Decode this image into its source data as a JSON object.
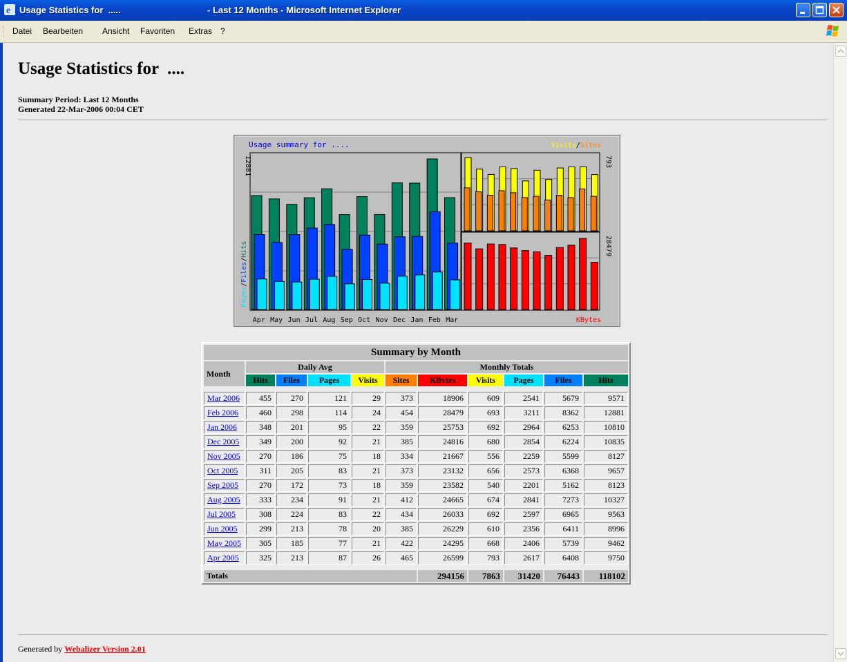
{
  "window": {
    "title_left": "Usage Statistics for  .....",
    "title_right": "- Last 12 Months - Microsoft Internet Explorer"
  },
  "menu": [
    "Datei",
    "Bearbeiten",
    "Ansicht",
    "Favoriten",
    "Extras",
    "?"
  ],
  "page": {
    "title": "Usage Statistics for  ....",
    "summary_period": "Summary Period: Last 12 Months",
    "generated": "Generated 22-Mar-2006 00:04 CET"
  },
  "colors": {
    "hits": "#00805c",
    "files": "#0040ff",
    "pages": "#00e0ff",
    "visits": "#ffff00",
    "sites": "#ff8000",
    "kbytes": "#ff0000",
    "chart_bg": "#c0c0c0",
    "chart_title": "#0000ff"
  },
  "chart_data": {
    "type": "bar",
    "title": "Usage summary for ....",
    "categories": [
      "Apr",
      "May",
      "Jun",
      "Jul",
      "Aug",
      "Sep",
      "Oct",
      "Nov",
      "Dec",
      "Jan",
      "Feb",
      "Mar"
    ],
    "left_panel": {
      "axis_label_parts": [
        "Pages",
        "Files",
        "Hits"
      ],
      "max_label": "12881",
      "series": [
        {
          "name": "Hits",
          "values": [
            9750,
            9462,
            8996,
            9563,
            10327,
            8123,
            9657,
            8127,
            10835,
            10810,
            12881,
            9571
          ]
        },
        {
          "name": "Files",
          "values": [
            6408,
            5739,
            6411,
            6965,
            7273,
            5162,
            6368,
            5599,
            6224,
            6253,
            8362,
            5679
          ]
        },
        {
          "name": "Pages",
          "values": [
            2617,
            2406,
            2356,
            2597,
            2841,
            2201,
            2573,
            2259,
            2854,
            2964,
            3211,
            2541
          ]
        }
      ]
    },
    "top_right_panel": {
      "legend_parts": [
        "Visits",
        "Sites"
      ],
      "max_label": "793",
      "series": [
        {
          "name": "Visits",
          "values": [
            793,
            668,
            610,
            692,
            674,
            540,
            656,
            556,
            680,
            692,
            693,
            609
          ]
        },
        {
          "name": "Sites",
          "values": [
            465,
            422,
            385,
            434,
            412,
            359,
            373,
            334,
            385,
            359,
            454,
            373
          ]
        }
      ]
    },
    "bottom_right_panel": {
      "legend": "KBytes",
      "max_label": "28479",
      "series": [
        {
          "name": "KBytes",
          "values": [
            26599,
            24295,
            26229,
            26033,
            24665,
            23582,
            23132,
            21667,
            24816,
            25753,
            28479,
            18906
          ]
        }
      ]
    }
  },
  "table": {
    "caption": "Summary by Month",
    "month_header": "Month",
    "daily_avg_header": "Daily Avg",
    "monthly_totals_header": "Monthly Totals",
    "daily_cols": [
      "Hits",
      "Files",
      "Pages",
      "Visits"
    ],
    "monthly_cols": [
      "Sites",
      "KBytes",
      "Visits",
      "Pages",
      "Files",
      "Hits"
    ],
    "rows": [
      {
        "month": "Mar 2006",
        "vals": [
          "455",
          "270",
          "121",
          "29",
          "373",
          "18906",
          "609",
          "2541",
          "5679",
          "9571"
        ]
      },
      {
        "month": "Feb 2006",
        "vals": [
          "460",
          "298",
          "114",
          "24",
          "454",
          "28479",
          "693",
          "3211",
          "8362",
          "12881"
        ]
      },
      {
        "month": "Jan 2006",
        "vals": [
          "348",
          "201",
          "95",
          "22",
          "359",
          "25753",
          "692",
          "2964",
          "6253",
          "10810"
        ]
      },
      {
        "month": "Dec 2005",
        "vals": [
          "349",
          "200",
          "92",
          "21",
          "385",
          "24816",
          "680",
          "2854",
          "6224",
          "10835"
        ]
      },
      {
        "month": "Nov 2005",
        "vals": [
          "270",
          "186",
          "75",
          "18",
          "334",
          "21667",
          "556",
          "2259",
          "5599",
          "8127"
        ]
      },
      {
        "month": "Oct 2005",
        "vals": [
          "311",
          "205",
          "83",
          "21",
          "373",
          "23132",
          "656",
          "2573",
          "6368",
          "9657"
        ]
      },
      {
        "month": "Sep 2005",
        "vals": [
          "270",
          "172",
          "73",
          "18",
          "359",
          "23582",
          "540",
          "2201",
          "5162",
          "8123"
        ]
      },
      {
        "month": "Aug 2005",
        "vals": [
          "333",
          "234",
          "91",
          "21",
          "412",
          "24665",
          "674",
          "2841",
          "7273",
          "10327"
        ]
      },
      {
        "month": "Jul 2005",
        "vals": [
          "308",
          "224",
          "83",
          "22",
          "434",
          "26033",
          "692",
          "2597",
          "6965",
          "9563"
        ]
      },
      {
        "month": "Jun 2005",
        "vals": [
          "299",
          "213",
          "78",
          "20",
          "385",
          "26229",
          "610",
          "2356",
          "6411",
          "8996"
        ]
      },
      {
        "month": "May 2005",
        "vals": [
          "305",
          "185",
          "77",
          "21",
          "422",
          "24295",
          "668",
          "2406",
          "5739",
          "9462"
        ]
      },
      {
        "month": "Apr 2005",
        "vals": [
          "325",
          "213",
          "87",
          "26",
          "465",
          "26599",
          "793",
          "2617",
          "6408",
          "9750"
        ]
      }
    ],
    "totals_label": "Totals",
    "totals": [
      "294156",
      "7863",
      "31420",
      "76443",
      "118102"
    ]
  },
  "footer": {
    "prefix": "Generated by",
    "link": "Webalizer Version 2.01"
  }
}
